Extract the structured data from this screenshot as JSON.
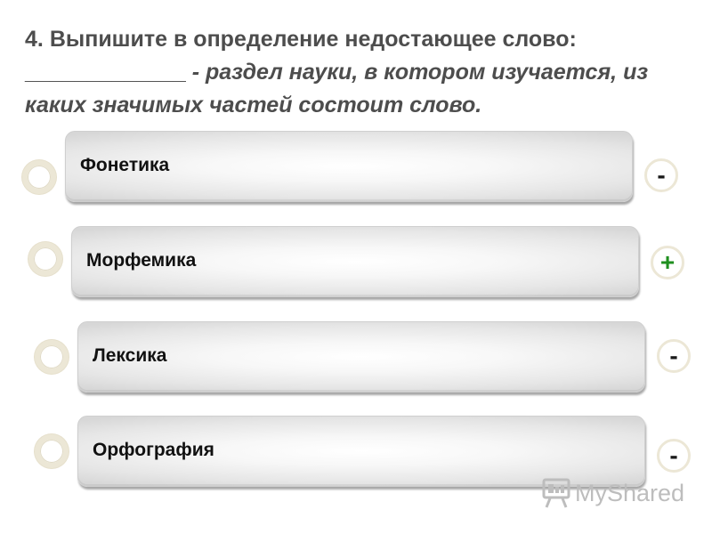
{
  "question": {
    "number": "4.",
    "prompt": "Выпишите в определение недостающее слово:",
    "blank": "_____________",
    "definition": "- раздел науки, в котором изучается, из каких значимых частей состоит слово."
  },
  "options": [
    {
      "label": "Фонетика",
      "mark": "-"
    },
    {
      "label": "Морфемика",
      "mark": "+"
    },
    {
      "label": "Лексика",
      "mark": "-"
    },
    {
      "label": "Орфография",
      "mark": "-"
    }
  ],
  "watermark": {
    "text": "MyShared",
    "icon": "presentation-board-icon"
  },
  "colors": {
    "question_text": "#4d4d4d",
    "correct_mark": "#1f8f1f",
    "wrong_mark": "#1a1a1a",
    "ring": "#ece7d6"
  }
}
